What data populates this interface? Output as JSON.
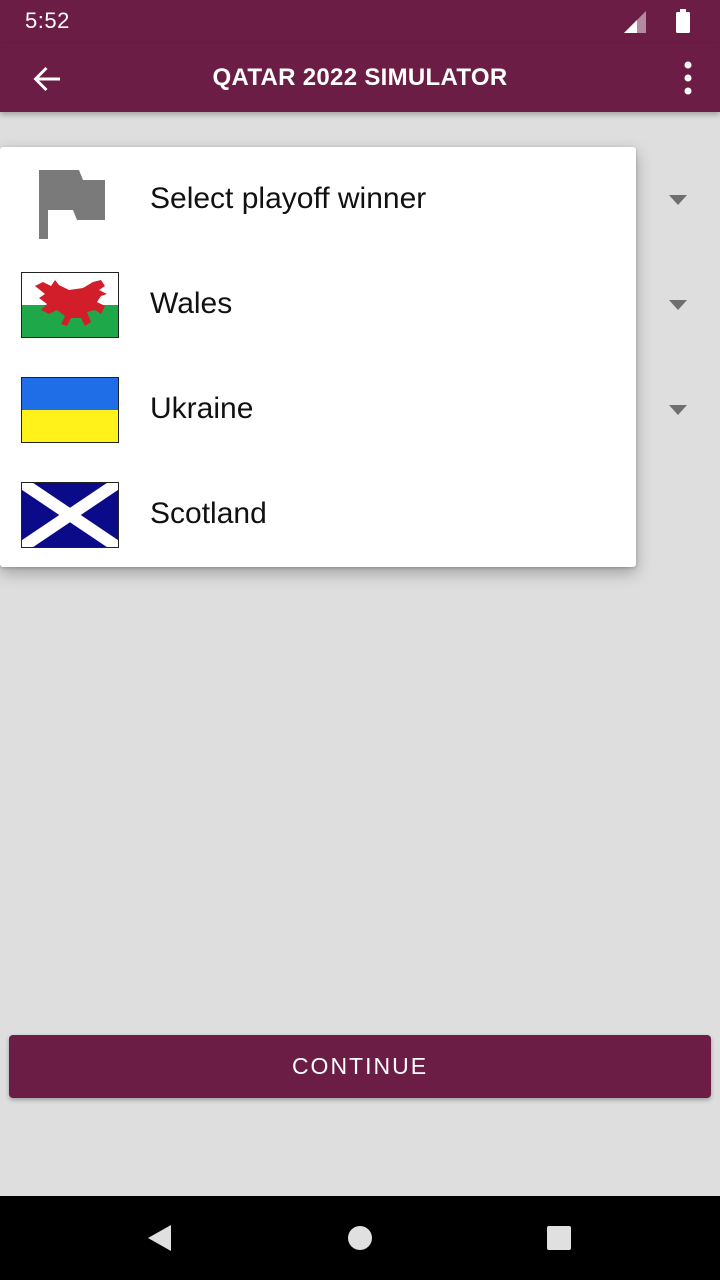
{
  "status": {
    "time": "5:52"
  },
  "app_bar": {
    "title": "QATAR 2022 SIMULATOR"
  },
  "dropdown": {
    "items": [
      {
        "label": "Select playoff winner",
        "icon": "flag-placeholder-icon"
      },
      {
        "label": "Wales",
        "icon": "wales-flag"
      },
      {
        "label": "Ukraine",
        "icon": "ukraine-flag"
      },
      {
        "label": "Scotland",
        "icon": "scotland-flag"
      }
    ]
  },
  "buttons": {
    "continue": "CONTINUE"
  },
  "colors": {
    "primary": "#6b1d45",
    "background": "#dedede"
  }
}
